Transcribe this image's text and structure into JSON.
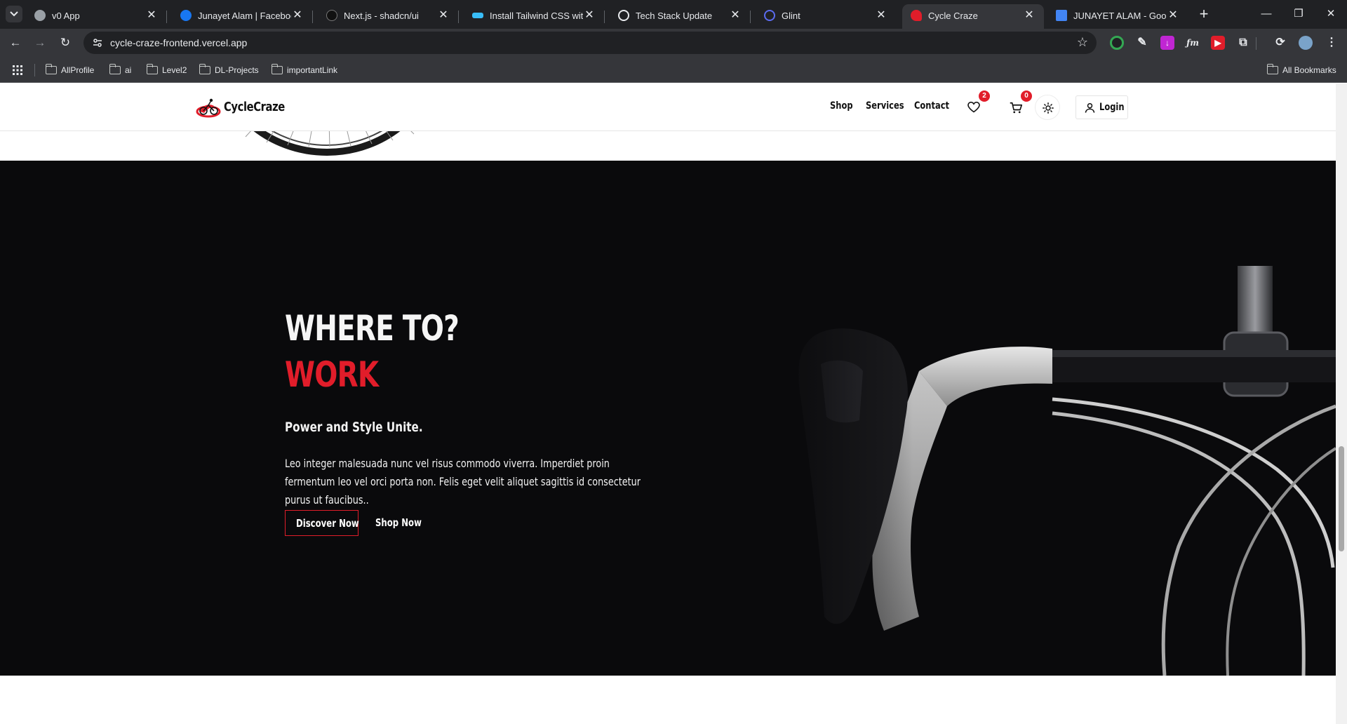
{
  "browser": {
    "tabs": [
      {
        "title": "v0 App",
        "icon": "globe-icon",
        "active": false
      },
      {
        "title": "Junayet Alam | Facebook",
        "icon": "facebook-icon",
        "active": false
      },
      {
        "title": "Next.js - shadcn/ui",
        "icon": "shadcn-icon",
        "active": false
      },
      {
        "title": "Install Tailwind CSS with N",
        "icon": "tailwind-icon",
        "active": false
      },
      {
        "title": "Tech Stack Update",
        "icon": "chatgpt-icon",
        "active": false
      },
      {
        "title": "Glint",
        "icon": "glint-icon",
        "active": false
      },
      {
        "title": "Cycle Craze",
        "icon": "cyclecraze-icon",
        "active": true
      },
      {
        "title": "JUNAYET ALAM - Google",
        "icon": "google-docs-icon",
        "active": false
      }
    ],
    "url": "cycle-craze-frontend.vercel.app",
    "bookmarks": [
      "AllProfile",
      "ai",
      "Level2",
      "DL-Projects",
      "importantLink"
    ],
    "all_bookmarks_label": "All Bookmarks"
  },
  "site": {
    "brand": "CycleCraze",
    "nav": {
      "shop": "Shop",
      "services": "Services",
      "contact": "Contact"
    },
    "wishlist_count": "2",
    "cart_count": "0",
    "login_label": "Login"
  },
  "hero": {
    "title_line1": "WHERE TO?",
    "title_line2": "WORK",
    "subheading": "Power and Style Unite.",
    "body": "Leo integer malesuada nunc vel risus commodo viverra. Imperdiet proin fermentum leo vel orci porta non. Felis eget velit aliquet sagittis id consectetur purus ut faucibus..",
    "primary_button": "Discover Now",
    "secondary_button": "Shop Now"
  },
  "colors": {
    "accent": "#e11d2a",
    "hero_bg": "#0a0a0c",
    "chrome_dark": "#202124",
    "chrome_mid": "#35363a"
  }
}
